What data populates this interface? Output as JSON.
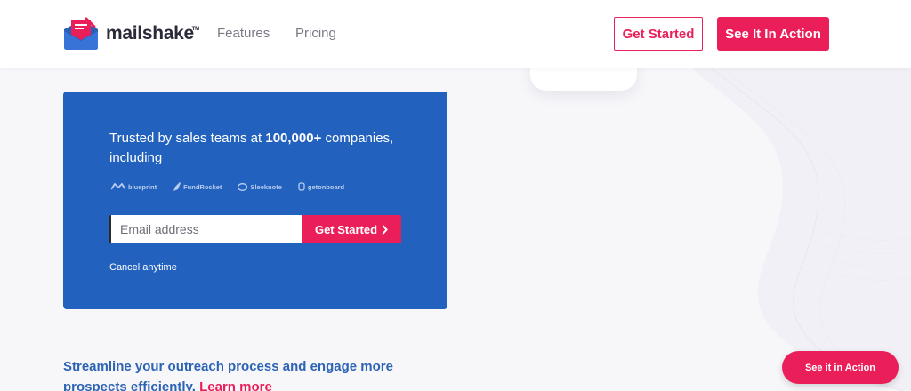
{
  "header": {
    "logo_text": "mailshake",
    "logo_tm": "TM",
    "nav": {
      "features": "Features",
      "pricing": "Pricing"
    },
    "get_started": "Get Started",
    "see_in_action": "See It In Action"
  },
  "hero": {
    "text_before": "Trusted by sales teams at ",
    "text_bold": "100,000+",
    "text_after": " companies, including",
    "partners": [
      "blueprint",
      "FundRocket",
      "Sleeknote",
      "getonboard"
    ],
    "email_placeholder": "Email address",
    "submit_label": "Get Started",
    "cancel_text": "Cancel anytime"
  },
  "tagline": {
    "text": "Streamline your outreach process and engage more prospects efficiently.",
    "link": "Learn more"
  },
  "floating": {
    "label": "See it in Action"
  },
  "colors": {
    "brand_pink": "#ea1f5a",
    "hero_blue": "#2261be",
    "tagline_blue": "#2d63b4"
  }
}
